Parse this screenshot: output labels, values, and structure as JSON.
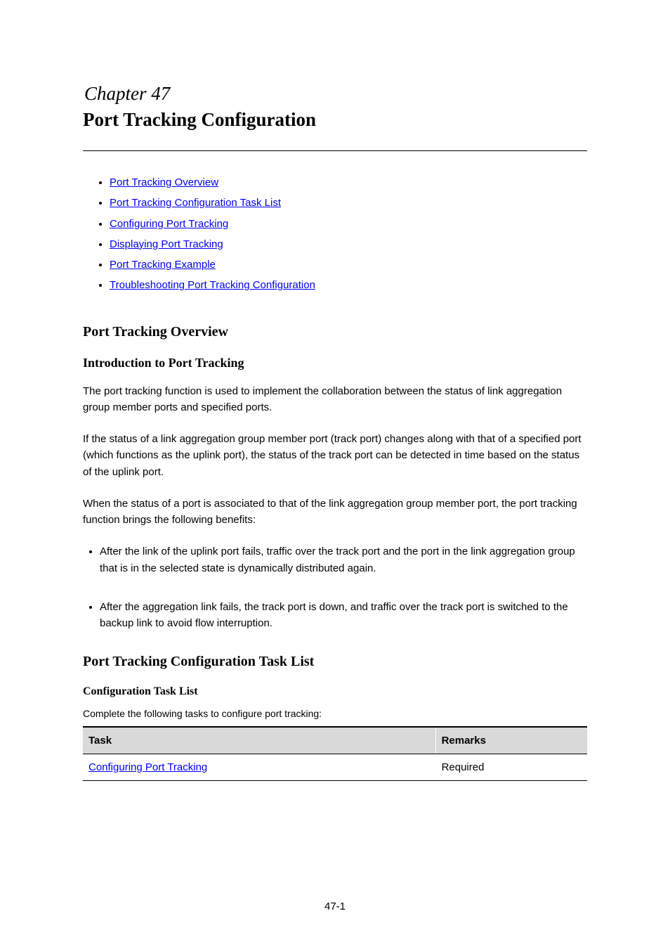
{
  "chapter": {
    "label": "Chapter 47",
    "title": "Port Tracking Configuration"
  },
  "toc": {
    "items": [
      "Port Tracking Overview",
      "Port Tracking Configuration Task List",
      "Configuring Port Tracking",
      "Displaying Port Tracking",
      "Port Tracking Example",
      "Troubleshooting Port Tracking Configuration"
    ]
  },
  "overview": {
    "heading": "Port Tracking Overview",
    "subhead": "Introduction to Port Tracking",
    "para1": "The port tracking function is used to implement the collaboration between the status of link aggregation group member ports and specified ports.",
    "para2": "If the status of a link aggregation group member port (track port) changes along with that of a specified port (which functions as the uplink port), the status of the track port can be detected in time based on the status of the uplink port.",
    "para3": "When the status of a port is associated to that of the link aggregation group member port, the port tracking function brings the following benefits:",
    "bullets": [
      "After the link of the uplink port fails, traffic over the track port and the port in the link aggregation group that is in the selected state is dynamically distributed again.",
      "After the aggregation link fails, the track port is down, and traffic over the track port is switched to the backup link to avoid flow interruption."
    ]
  },
  "taskList": {
    "heading": "Port Tracking Configuration Task List",
    "configSubhead": "Configuration Task List",
    "caption": "Complete the following tasks to configure port tracking:",
    "columns": [
      "Task",
      "Remarks"
    ],
    "rows": [
      {
        "task": "Configuring Port Tracking",
        "remarks": "Required"
      }
    ]
  },
  "pageNumber": "47-1"
}
